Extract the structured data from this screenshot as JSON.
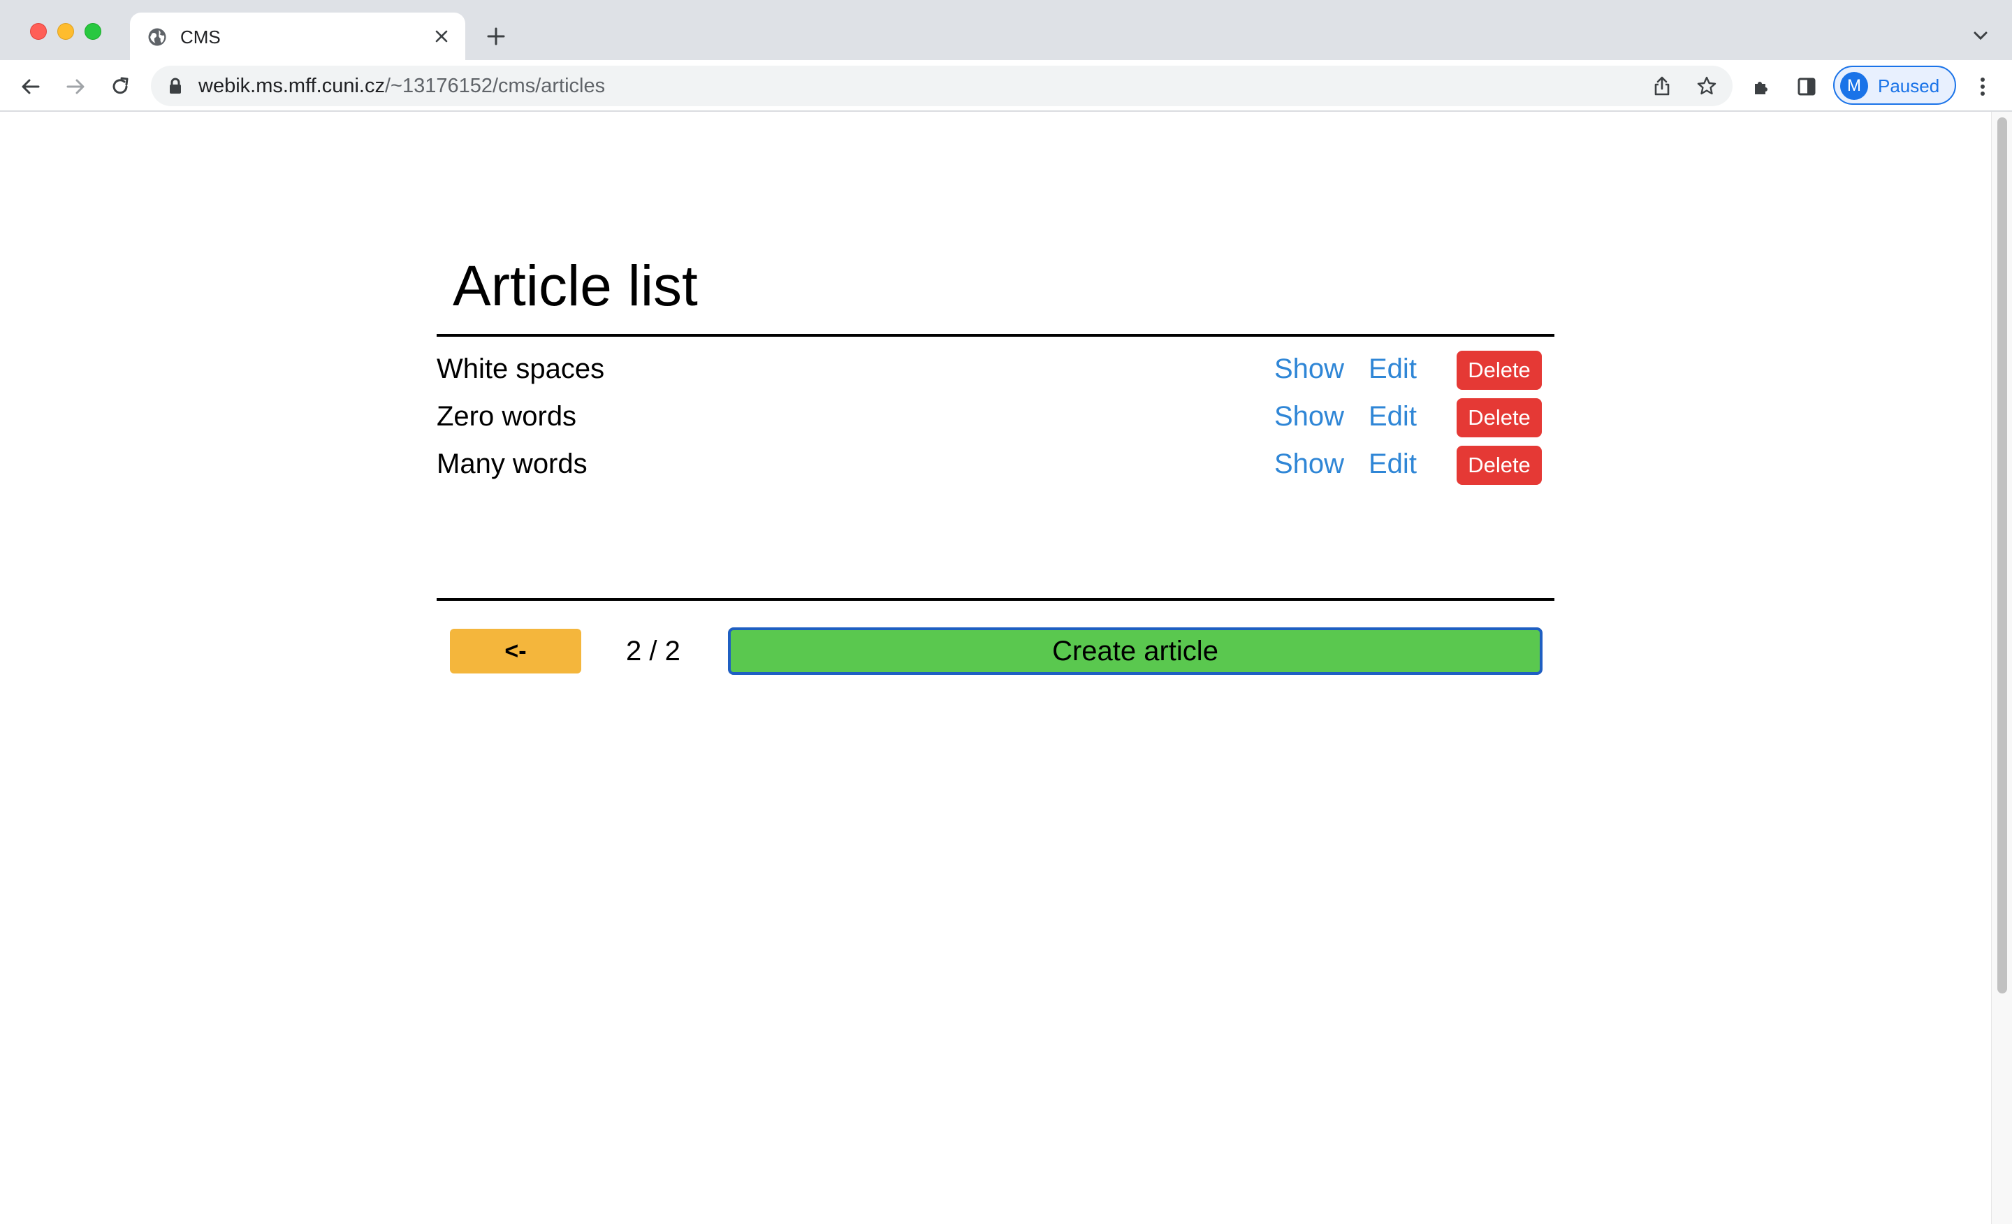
{
  "browser": {
    "tab_title": "CMS",
    "url_host": "webik.ms.mff.cuni.cz",
    "url_path": "/~13176152/cms/articles",
    "profile_initial": "M",
    "profile_status": "Paused"
  },
  "page": {
    "title": "Article list",
    "articles": [
      {
        "title": "White spaces",
        "show": "Show",
        "edit": "Edit",
        "delete": "Delete"
      },
      {
        "title": "Zero words",
        "show": "Show",
        "edit": "Edit",
        "delete": "Delete"
      },
      {
        "title": "Many words",
        "show": "Show",
        "edit": "Edit",
        "delete": "Delete"
      }
    ],
    "prev_label": "<-",
    "pager": "2 / 2",
    "create_label": "Create article"
  },
  "colors": {
    "link": "#2f86d6",
    "delete": "#e53935",
    "prev": "#f4b63c",
    "create": "#5ac84f",
    "create_border": "#1f5fc2"
  },
  "icons": [
    "globe-icon",
    "close-icon",
    "plus-icon",
    "chevron-down-icon",
    "back-icon",
    "forward-icon",
    "reload-icon",
    "lock-icon",
    "share-icon",
    "star-icon",
    "extensions-icon",
    "side-panel-icon",
    "more-icon"
  ]
}
